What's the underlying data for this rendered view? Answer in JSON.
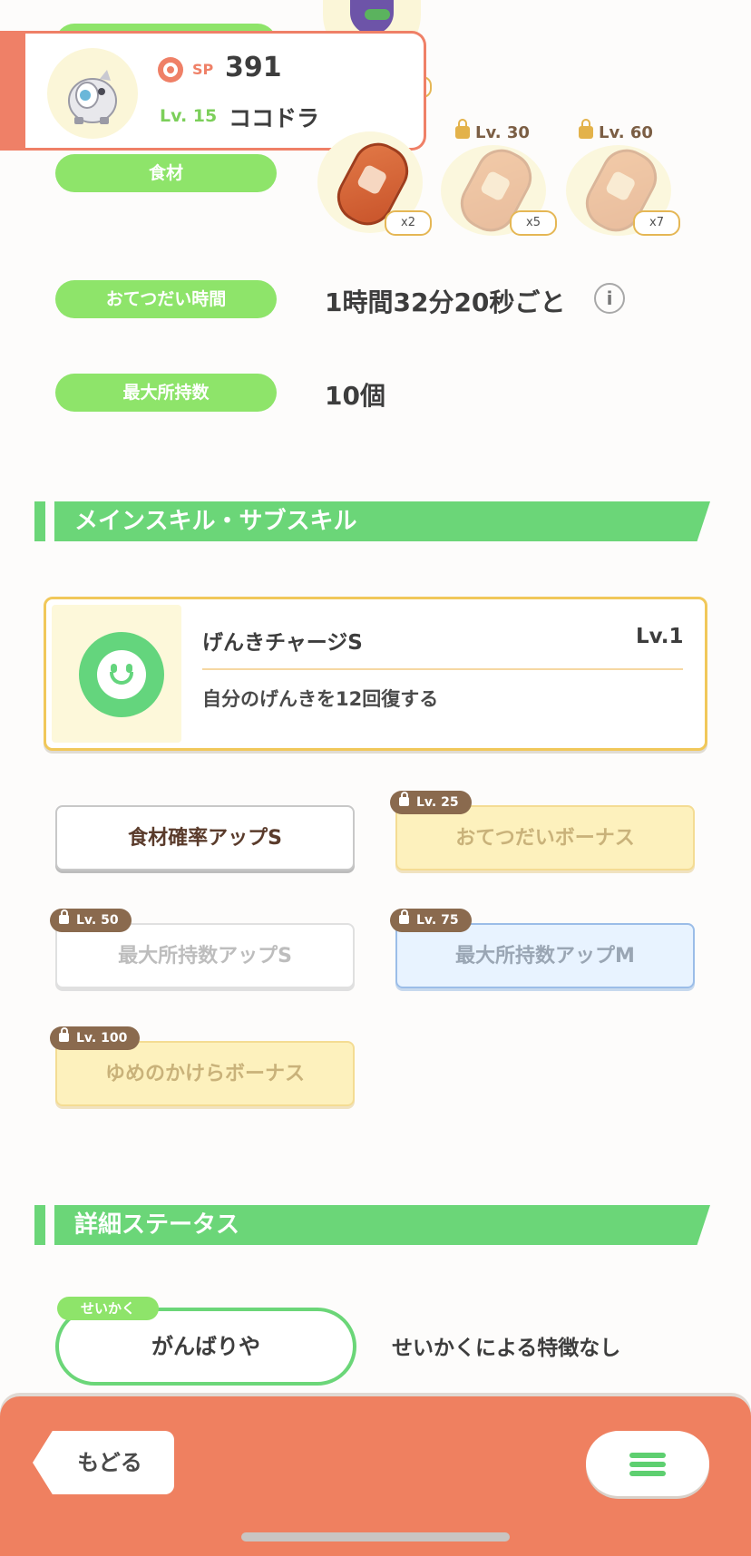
{
  "pokemon": {
    "sp_label": "SP",
    "sp_value": "391",
    "level": "Lv. 15",
    "name": "ココドラ"
  },
  "ingredients": {
    "label": "食材",
    "items": [
      {
        "qty": "x2",
        "locked": false,
        "unlock": ""
      },
      {
        "qty": "x5",
        "locked": true,
        "unlock": "Lv. 30"
      },
      {
        "qty": "x7",
        "locked": true,
        "unlock": "Lv. 60"
      }
    ]
  },
  "help_time": {
    "label": "おてつだい時間",
    "value": "1時間32分20秒ごと",
    "info_icon": "info-icon"
  },
  "max_carry": {
    "label": "最大所持数",
    "value": "10個"
  },
  "skills_section": {
    "title": "メインスキル・サブスキル",
    "main_skill": {
      "name": "げんきチャージS",
      "level": "Lv.1",
      "description": "自分のげんきを12回復する",
      "icon": "smiley-icon"
    },
    "sub_skills": [
      {
        "label": "食材確率アップS",
        "lock": ""
      },
      {
        "label": "おてつだいボーナス",
        "lock": "Lv. 25"
      },
      {
        "label": "最大所持数アップS",
        "lock": "Lv. 50"
      },
      {
        "label": "最大所持数アップM",
        "lock": "Lv. 75"
      },
      {
        "label": "ゆめのかけらボーナス",
        "lock": "Lv. 100"
      }
    ]
  },
  "details_section": {
    "title": "詳細ステータス",
    "nature_tag": "せいかく",
    "nature": "がんばりや",
    "nature_effect": "せいかくによる特徴なし"
  },
  "bottom_bar": {
    "back_label": "もどる",
    "menu_icon": "hamburger-icon"
  },
  "colors": {
    "accent_orange": "#ef8060",
    "accent_green": "#6bd678",
    "pill_green": "#8ee46a",
    "gold_border": "#f1c85a"
  }
}
